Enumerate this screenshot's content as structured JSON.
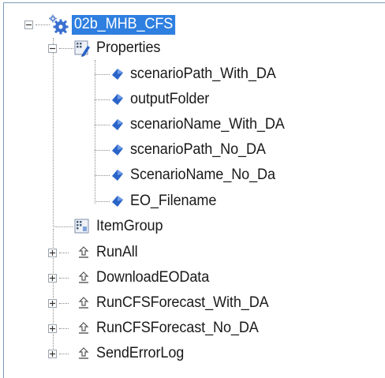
{
  "tree": {
    "root": {
      "label": "02b_MHB_CFS",
      "icon": "gear-icon",
      "state": "expanded"
    },
    "properties": {
      "label": "Properties",
      "icon": "property-group-icon",
      "state": "expanded",
      "items": [
        {
          "label": "scenarioPath_With_DA",
          "icon": "property-icon"
        },
        {
          "label": "outputFolder",
          "icon": "property-icon"
        },
        {
          "label": "scenarioName_With_DA",
          "icon": "property-icon"
        },
        {
          "label": "scenarioPath_No_DA",
          "icon": "property-icon"
        },
        {
          "label": "ScenarioName_No_Da",
          "icon": "property-icon"
        },
        {
          "label": "EO_Filename",
          "icon": "property-icon"
        }
      ]
    },
    "item_group": {
      "label": "ItemGroup",
      "icon": "item-group-icon"
    },
    "targets": [
      {
        "label": "RunAll",
        "icon": "target-icon",
        "state": "collapsed"
      },
      {
        "label": "DownloadEOData",
        "icon": "target-icon",
        "state": "collapsed"
      },
      {
        "label": "RunCFSForecast_With_DA",
        "icon": "target-icon",
        "state": "collapsed"
      },
      {
        "label": "RunCFSForecast_No_DA",
        "icon": "target-icon",
        "state": "collapsed"
      },
      {
        "label": "SendErrorLog",
        "icon": "target-icon",
        "state": "collapsed"
      }
    ]
  },
  "colors": {
    "selection": "#2f7fe0",
    "property_diamond": "#2a64c8",
    "gear": "#3a6fd0",
    "border": "#7a9ab8"
  }
}
